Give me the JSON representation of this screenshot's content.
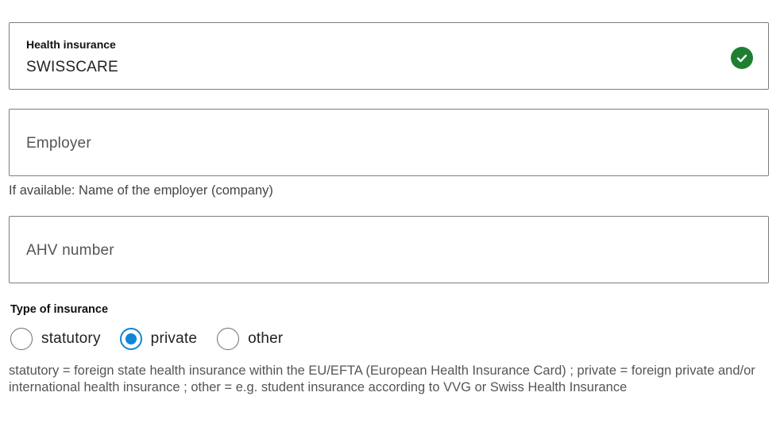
{
  "health_insurance": {
    "label": "Health insurance",
    "value": "SWISSCARE",
    "status_icon": "check-circle-icon",
    "status_color": "#1e7f33"
  },
  "employer": {
    "placeholder": "Employer",
    "hint": "If available: Name of the employer (company)"
  },
  "ahv": {
    "placeholder": "AHV number"
  },
  "insurance_type": {
    "label": "Type of insurance",
    "selected": "private",
    "accent_color": "#0f86d6",
    "options": [
      {
        "label": "statutory",
        "checked": false
      },
      {
        "label": "private",
        "checked": true
      },
      {
        "label": "other",
        "checked": false
      }
    ],
    "description": "statutory = foreign state health insurance within the EU/EFTA (European Health Insurance Card) ; private = foreign private and/or international health insurance ; other = e.g. student insurance according to VVG or Swiss Health Insurance"
  }
}
